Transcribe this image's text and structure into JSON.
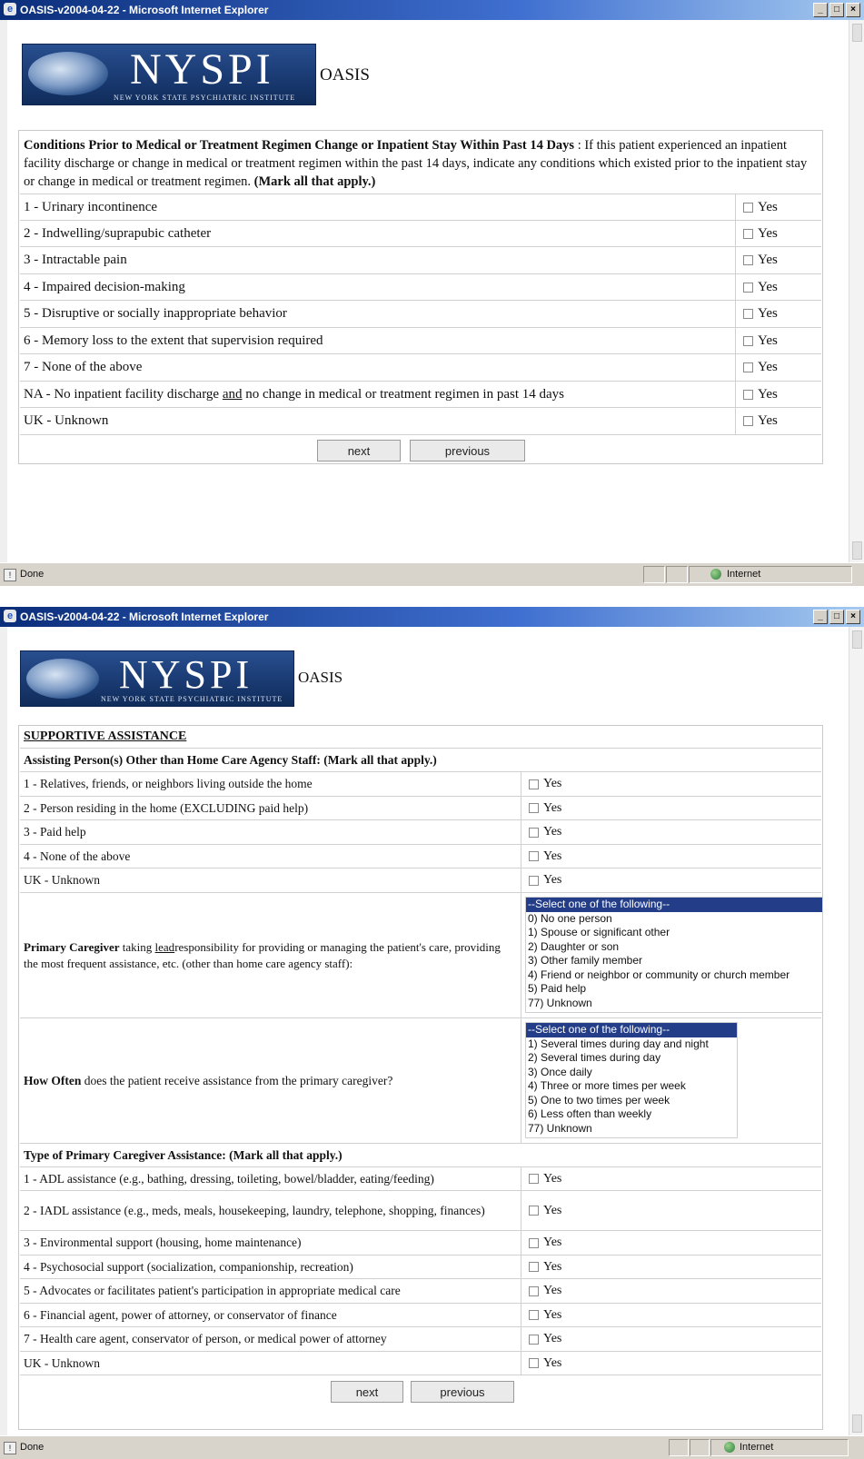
{
  "window1": {
    "title": "OASIS-v2004-04-22 - Microsoft Internet Explorer",
    "logo_text": "NYSPI",
    "logo_subtext": "NEW YORK STATE PSYCHIATRIC INSTITUTE",
    "app_label": "OASIS",
    "heading_bold": "Conditions Prior to Medical or Treatment Regimen Change or Inpatient Stay Within Past 14 Days",
    "heading_text": " : If this patient experienced an inpatient facility discharge or change in medical or treatment regimen within the past 14 days, indicate any conditions which existed prior to the inpatient stay or change in medical or treatment regimen. ",
    "heading_instruction": "(Mark all that apply.)",
    "items": [
      {
        "label": "1 - Urinary incontinence",
        "check": "Yes"
      },
      {
        "label": "2 - Indwelling/suprapubic catheter",
        "check": "Yes"
      },
      {
        "label": "3 - Intractable pain",
        "check": "Yes"
      },
      {
        "label": "4 - Impaired decision-making",
        "check": "Yes"
      },
      {
        "label": "5 - Disruptive or socially inappropriate behavior",
        "check": "Yes"
      },
      {
        "label": "6 - Memory loss to the extent that supervision required",
        "check": "Yes"
      },
      {
        "label": "7 - None of the above",
        "check": "Yes"
      },
      {
        "label_pre": "NA - No inpatient facility discharge ",
        "label_u": "and",
        "label_post": " no change in medical or treatment regimen in past 14 days",
        "check": "Yes"
      },
      {
        "label": "UK - Unknown",
        "check": "Yes"
      }
    ],
    "next_label": "next",
    "previous_label": "previous",
    "status_text": "Done",
    "zone_text": "Internet",
    "window_buttons": [
      "_",
      "□",
      "×"
    ]
  },
  "window2": {
    "title": "OASIS-v2004-04-22 - Microsoft Internet Explorer",
    "logo_text": "NYSPI",
    "logo_subtext": "NEW YORK STATE PSYCHIATRIC INSTITUTE",
    "app_label": "OASIS",
    "section_title": "SUPPORTIVE ASSISTANCE",
    "assisting_bold": "Assisting Person(s) Other than Home Care Agency Staff:",
    "assisting_instruction": " (Mark all that apply.)",
    "assisting_items": [
      {
        "label": "1 - Relatives, friends, or neighbors living outside the home",
        "check": "Yes"
      },
      {
        "label": "2 - Person residing in the home (EXCLUDING paid help)",
        "check": "Yes"
      },
      {
        "label": "3 - Paid help",
        "check": "Yes"
      },
      {
        "label": "4 - None of the above",
        "check": "Yes"
      },
      {
        "label": "UK - Unknown",
        "check": "Yes"
      }
    ],
    "primary_caregiver": {
      "bold": "Primary Caregiver",
      "pre": " taking ",
      "underlined": "lead",
      "post": "responsibility for providing or managing the patient's care, providing the most frequent assistance, etc. (other than home care agency staff):",
      "options": [
        "--Select one of the following--",
        "0) No one person",
        "1) Spouse or significant other",
        "2) Daughter or son",
        "3) Other family member",
        "4) Friend or neighbor or community or church member",
        "5) Paid help",
        "77) Unknown"
      ]
    },
    "how_often": {
      "bold": "How Often",
      "text": " does the patient receive assistance from the primary caregiver?",
      "options": [
        "--Select one of the following--",
        "1) Several times during day and night",
        "2) Several times during day",
        "3) Once daily",
        "4) Three or more times per week",
        "5) One to two times per week",
        "6) Less often than weekly",
        "77) Unknown"
      ]
    },
    "type_bold": "Type of Primary Caregiver Assistance:",
    "type_instruction": " (Mark all that apply.)",
    "type_items": [
      {
        "label": "1 - ADL assistance (e.g., bathing, dressing, toileting, bowel/bladder, eating/feeding)",
        "check": "Yes"
      },
      {
        "label": "2 - IADL assistance (e.g., meds, meals, housekeeping, laundry, telephone, shopping, finances)",
        "check": "Yes"
      },
      {
        "label": "3 - Environmental support (housing, home maintenance)",
        "check": "Yes"
      },
      {
        "label": "4 - Psychosocial support (socialization, companionship, recreation)",
        "check": "Yes"
      },
      {
        "label": "5 - Advocates or facilitates patient's participation in appropriate medical care",
        "check": "Yes"
      },
      {
        "label": "6 - Financial agent, power of attorney, or conservator of finance",
        "check": "Yes"
      },
      {
        "label": "7 - Health care agent, conservator of person, or medical power of attorney",
        "check": "Yes"
      },
      {
        "label": "UK - Unknown",
        "check": "Yes"
      }
    ],
    "next_label": "next",
    "previous_label": "previous",
    "status_text": "Done",
    "zone_text": "Internet",
    "window_buttons": [
      "_",
      "□",
      "×"
    ]
  }
}
